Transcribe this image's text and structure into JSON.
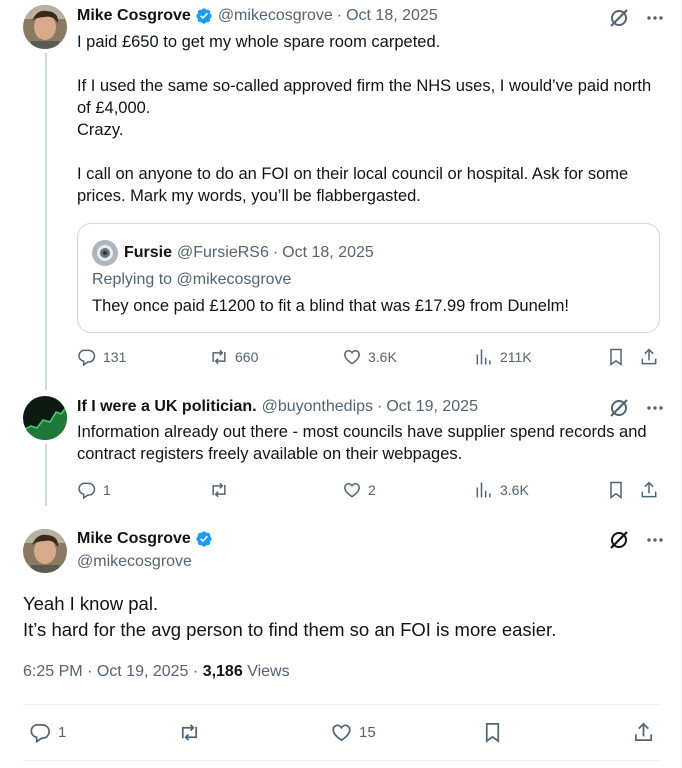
{
  "tweet1": {
    "name": "Mike Cosgrove",
    "handle": "@mikecosgrove",
    "dot": "·",
    "date": "Oct 18, 2025",
    "text": "I paid £650 to get my whole spare room carpeted.\n\nIf I used the same so-called approved firm the NHS uses, I would’ve paid north of £4,000.\nCrazy.\n\nI call on anyone to do an FOI on their local council or hospital. Ask for some prices. Mark my words, you’ll be flabbergasted.",
    "quote": {
      "name": "Fursie",
      "handle": "@FursieRS6",
      "dot": "·",
      "date": "Oct 18, 2025",
      "replying_prefix": "Replying to",
      "replying_handle": "@mikecosgrove",
      "text": "They once paid £1200 to fit a blind that was £17.99 from Dunelm!"
    },
    "stats": {
      "replies": "131",
      "reposts": "660",
      "likes": "3.6K",
      "views": "211K"
    }
  },
  "tweet2": {
    "name": "If I were a UK politician.",
    "handle": "@buyonthedips",
    "dot": "·",
    "date": "Oct 19, 2025",
    "text": "Information already out there - most councils have supplier spend records and contract registers freely available on their webpages.",
    "stats": {
      "replies": "1",
      "reposts": "",
      "likes": "2",
      "views": "3.6K"
    }
  },
  "main_tweet": {
    "name": "Mike Cosgrove",
    "handle": "@mikecosgrove",
    "text": "Yeah I know pal.\nIt’s hard for the avg person to find them so an FOI is more easier.",
    "time": "6:25 PM",
    "dot": "·",
    "date": "Oct 19, 2025",
    "dot2": "·",
    "views_count": "3,186",
    "views_label": "Views",
    "stats": {
      "replies": "1",
      "likes": "15"
    }
  },
  "icons": {
    "verified": "verified-badge-icon",
    "grok": "grok-icon",
    "more": "more-icon",
    "reply": "reply-icon",
    "repost": "repost-icon",
    "like": "like-icon",
    "views": "views-icon",
    "bookmark": "bookmark-icon",
    "share": "share-icon"
  },
  "colors": {
    "verified": "#1d9bf0",
    "secondary_text": "#536471",
    "text": "#0f1419",
    "border": "#cfd9de"
  }
}
